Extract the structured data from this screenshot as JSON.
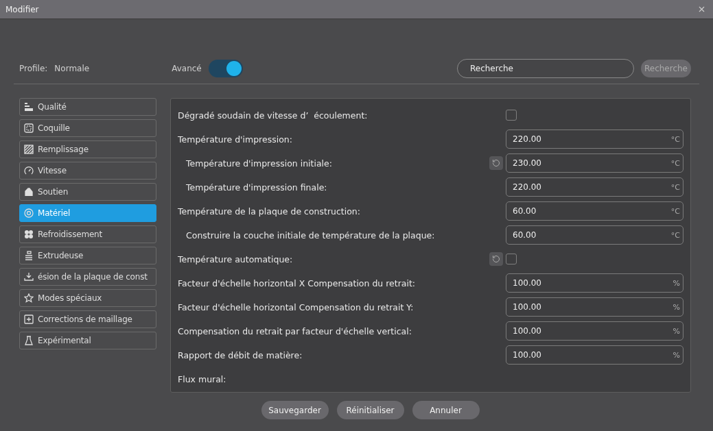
{
  "window": {
    "title": "Modifier"
  },
  "header": {
    "profile_label": "Profile:",
    "profile_value": "Normale",
    "advanced_label": "Avancé",
    "advanced_on": true,
    "search": {
      "value": "Recherche"
    },
    "search_button": "Recherche"
  },
  "sidebar": {
    "items": [
      {
        "label": "Qualité",
        "selected": false
      },
      {
        "label": "Coquille",
        "selected": false
      },
      {
        "label": "Remplissage",
        "selected": false
      },
      {
        "label": "Vitesse",
        "selected": false
      },
      {
        "label": "Soutien",
        "selected": false
      },
      {
        "label": "Matériel",
        "selected": true
      },
      {
        "label": "Refroidissement",
        "selected": false
      },
      {
        "label": "Extrudeuse",
        "selected": false
      },
      {
        "label": "ésion de la plaque de const",
        "selected": false
      },
      {
        "label": "Modes spéciaux",
        "selected": false
      },
      {
        "label": "Corrections de maillage",
        "selected": false
      },
      {
        "label": "Expérimental",
        "selected": false
      }
    ]
  },
  "settings": [
    {
      "kind": "checkbox",
      "label": "Dégradé soudain de vitesse d’  écoulement:",
      "indented": false,
      "reset": false,
      "checked": false
    },
    {
      "kind": "number",
      "label": "Température d'impression:",
      "indented": false,
      "reset": false,
      "value": "220.00",
      "unit": "°C"
    },
    {
      "kind": "number",
      "label": "Température d'impression initiale:",
      "indented": true,
      "reset": true,
      "value": "230.00",
      "unit": "°C"
    },
    {
      "kind": "number",
      "label": "Température d'impression finale:",
      "indented": true,
      "reset": false,
      "value": "220.00",
      "unit": "°C"
    },
    {
      "kind": "number",
      "label": "Température de la plaque de construction:",
      "indented": false,
      "reset": false,
      "value": "60.00",
      "unit": "°C"
    },
    {
      "kind": "number",
      "label": "Construire la couche initiale de température de la plaque:",
      "indented": true,
      "reset": false,
      "value": "60.00",
      "unit": "°C"
    },
    {
      "kind": "checkbox",
      "label": "Température automatique:",
      "indented": false,
      "reset": true,
      "checked": false
    },
    {
      "kind": "number",
      "label": "Facteur d'échelle horizontal X Compensation du retrait:",
      "indented": false,
      "reset": false,
      "value": "100.00",
      "unit": "%"
    },
    {
      "kind": "number",
      "label": "Facteur d'échelle horizontal Compensation du retrait Y:",
      "indented": false,
      "reset": false,
      "value": "100.00",
      "unit": "%"
    },
    {
      "kind": "number",
      "label": "Compensation du retrait par facteur d'échelle vertical:",
      "indented": false,
      "reset": false,
      "value": "100.00",
      "unit": "%"
    },
    {
      "kind": "number",
      "label": "Rapport de débit de matière:",
      "indented": false,
      "reset": false,
      "value": "100.00",
      "unit": "%"
    },
    {
      "kind": "label",
      "label": "Flux mural:",
      "indented": false,
      "reset": false
    }
  ],
  "buttons": [
    "Sauvegarder",
    "Réinitialiser",
    "Annuler"
  ]
}
